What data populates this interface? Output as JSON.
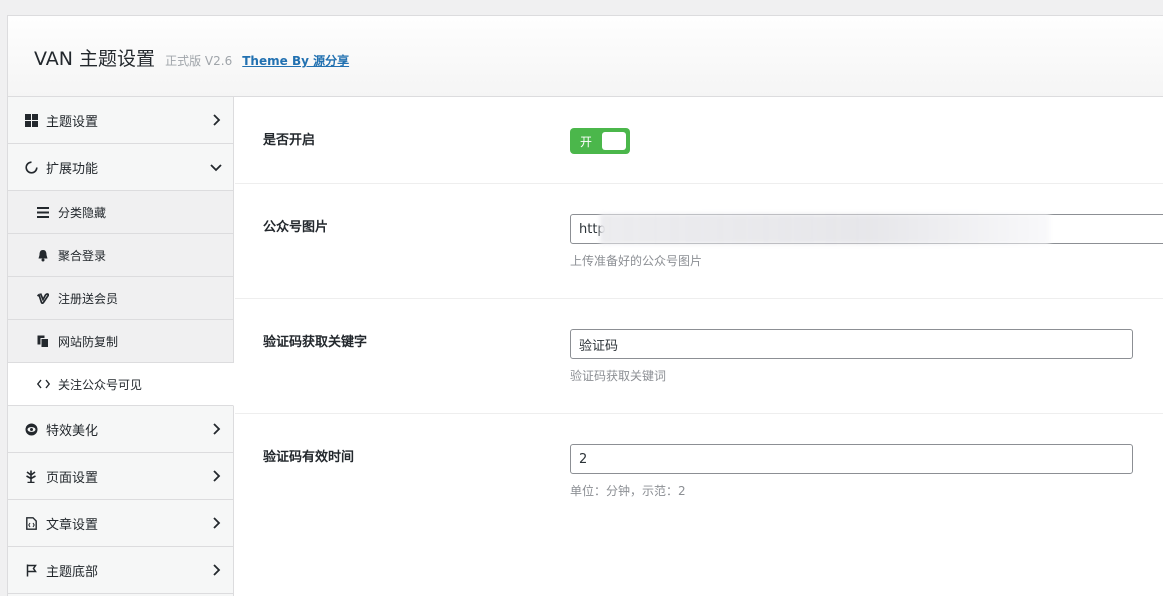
{
  "header": {
    "title": "VAN 主题设置",
    "version": "正式版 V2.6",
    "theme_link": "Theme By 源分享"
  },
  "sidebar": {
    "items": [
      {
        "label": "主题设置",
        "icon": "grid-icon",
        "expanded": false
      },
      {
        "label": "扩展功能",
        "icon": "circle-notch-icon",
        "expanded": true
      },
      {
        "label": "特效美化",
        "icon": "eye-icon",
        "expanded": false
      },
      {
        "label": "页面设置",
        "icon": "leaf-icon",
        "expanded": false
      },
      {
        "label": "文章设置",
        "icon": "file-code-icon",
        "expanded": false
      },
      {
        "label": "主题底部",
        "icon": "flag-icon",
        "expanded": false
      }
    ],
    "sub_items": [
      {
        "label": "分类隐藏",
        "icon": "bars-icon"
      },
      {
        "label": "聚合登录",
        "icon": "bell-icon"
      },
      {
        "label": "注册送会员",
        "icon": "vimeo-icon"
      },
      {
        "label": "网站防复制",
        "icon": "copy-icon"
      },
      {
        "label": "关注公众号可见",
        "icon": "code-icon",
        "active": true
      }
    ]
  },
  "form": {
    "enable": {
      "label": "是否开启",
      "toggle_text": "开",
      "on": true
    },
    "qr_image": {
      "label": "公众号图片",
      "value": "http",
      "help": "上传准备好的公众号图片"
    },
    "keyword": {
      "label": "验证码获取关键字",
      "value": "验证码",
      "help": "验证码获取关键词"
    },
    "expire": {
      "label": "验证码有效时间",
      "value": "2",
      "help": "单位：分钟，示范：2"
    }
  },
  "colors": {
    "toggle_on": "#4bb74b",
    "link": "#2271b1"
  }
}
